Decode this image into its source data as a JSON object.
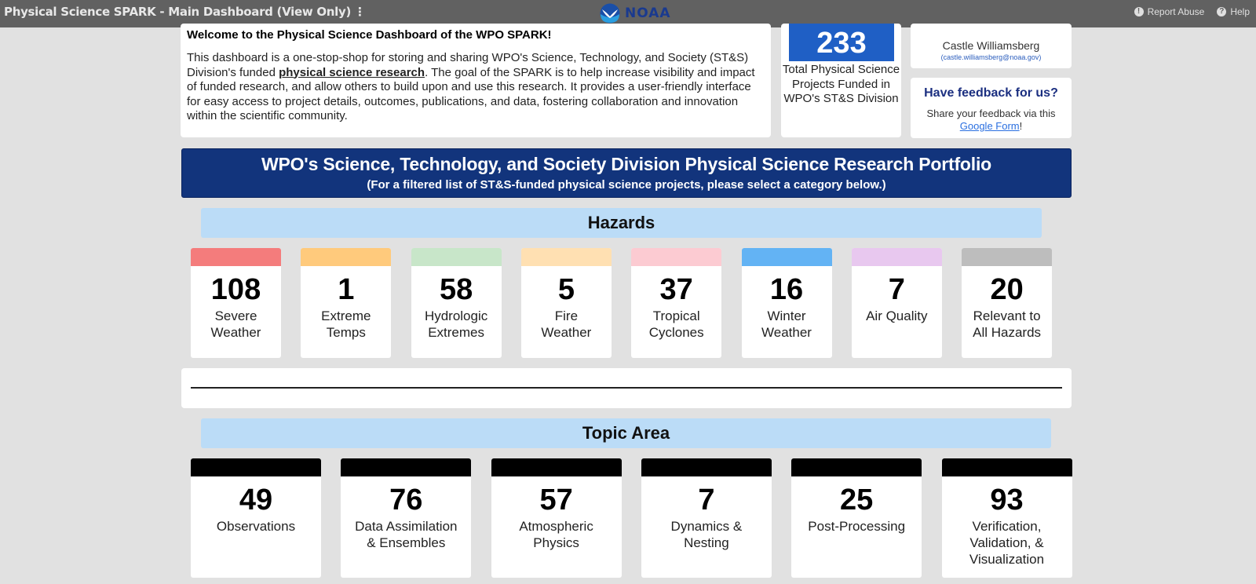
{
  "topbar": {
    "title": "Physical Science SPARK - Main Dashboard (View Only)",
    "menu_icon": "more-vert-icon",
    "logo_text": "NOAA",
    "report_abuse": "Report Abuse",
    "help": "Help"
  },
  "welcome": {
    "heading": "Welcome to the Physical Science Dashboard of the WPO SPARK!",
    "text_before_link": "This dashboard is a one-stop-shop for storing and sharing WPO's Science, Technology, and Society (ST&S) Division's funded ",
    "link_text": "physical science research",
    "text_after_link": ". The goal of the SPARK is to help increase visibility and impact of funded research, and allow others to build upon and use this research. It provides a user-friendly interface for easy access to project details, outcomes, publications, and data, fostering collaboration and innovation within the scientific community."
  },
  "total": {
    "value": "233",
    "label": "Total Physical Science Projects Funded in WPO's ST&S Division"
  },
  "contact": {
    "name": "Castle Williamsberg",
    "email": "(castle.williamsberg@noaa.gov)"
  },
  "feedback": {
    "question": "Have feedback for us?",
    "text": "Share your feedback via this ",
    "link_text": "Google Form",
    "suffix": "!"
  },
  "banner": {
    "title": "WPO's Science, Technology, and Society Division Physical Science Research Portfolio",
    "subtitle": "(For a filtered list of ST&S-funded physical science projects, please select a category below.)"
  },
  "hazards": {
    "heading": "Hazards",
    "tiles": [
      {
        "value": "108",
        "label": "Severe Weather",
        "color": "#f47c7c"
      },
      {
        "value": "1",
        "label": "Extreme Temps",
        "color": "#ffca7c"
      },
      {
        "value": "58",
        "label": "Hydrologic Extremes",
        "color": "#c8e6c9"
      },
      {
        "value": "5",
        "label": "Fire Weather",
        "color": "#ffe0b2"
      },
      {
        "value": "37",
        "label": "Tropical Cyclones",
        "color": "#fccbd2"
      },
      {
        "value": "16",
        "label": "Winter Weather",
        "color": "#63b3f4"
      },
      {
        "value": "7",
        "label": "Air Quality",
        "color": "#e8c8ef"
      },
      {
        "value": "20",
        "label": "Relevant to All Hazards",
        "color": "#bdbdbd"
      }
    ]
  },
  "topics": {
    "heading": "Topic Area",
    "tiles": [
      {
        "value": "49",
        "label": "Observations",
        "color": "#000000"
      },
      {
        "value": "76",
        "label": "Data Assimilation & Ensembles",
        "color": "#000000"
      },
      {
        "value": "57",
        "label": "Atmospheric Physics",
        "color": "#000000"
      },
      {
        "value": "7",
        "label": "Dynamics & Nesting",
        "color": "#000000"
      },
      {
        "value": "25",
        "label": "Post-Processing",
        "color": "#000000"
      },
      {
        "value": "93",
        "label": "Verification, Validation, & Visualization",
        "color": "#000000"
      }
    ]
  }
}
